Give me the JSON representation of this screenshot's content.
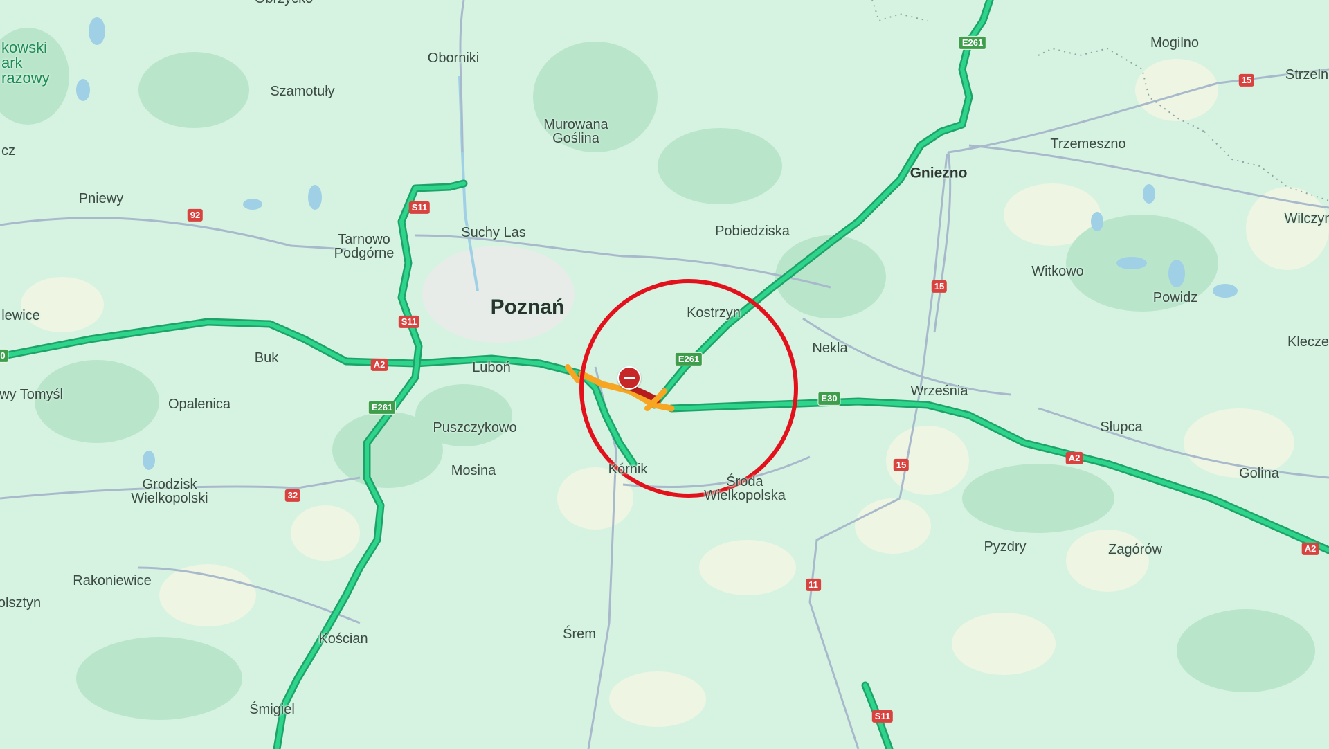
{
  "map": {
    "colors": {
      "land": "#d6f3e2",
      "forest": "#b9e5cb",
      "field": "#eef5e3",
      "water": "#9fd0e6",
      "minor_road": "#a9b9cc",
      "traffic_free_flow": "#23c47a",
      "traffic_slow": "#f6a623",
      "traffic_jam": "#b71c1c",
      "highlight_circle": "#e3111b"
    },
    "cities": [
      {
        "id": "poznan",
        "name": "Poznań"
      },
      {
        "id": "gniezno",
        "name": "Gniezno"
      }
    ],
    "places": [
      {
        "id": "obrzycko",
        "name": "Obrzycko"
      },
      {
        "id": "oborniki",
        "name": "Oborniki"
      },
      {
        "id": "mogilno",
        "name": "Mogilno"
      },
      {
        "id": "strzelno",
        "name": "Strzeln"
      },
      {
        "id": "szamotuly",
        "name": "Szamotuły"
      },
      {
        "id": "murowana",
        "name": "Murowana\nGoślina"
      },
      {
        "id": "trzemeszno",
        "name": "Trzemeszno"
      },
      {
        "id": "pniewy",
        "name": "Pniewy"
      },
      {
        "id": "tarnowo",
        "name": "Tarnowo\nPodgórne"
      },
      {
        "id": "suchy_las",
        "name": "Suchy Las"
      },
      {
        "id": "pobiedziska",
        "name": "Pobiedziska"
      },
      {
        "id": "wilczyn",
        "name": "Wilczyn"
      },
      {
        "id": "witkowo",
        "name": "Witkowo"
      },
      {
        "id": "powidz",
        "name": "Powidz"
      },
      {
        "id": "lwowek",
        "name": "lewice"
      },
      {
        "id": "kostrzyn",
        "name": "Kostrzyn"
      },
      {
        "id": "nekla",
        "name": "Nekla"
      },
      {
        "id": "kleczew",
        "name": "Klecze"
      },
      {
        "id": "buk",
        "name": "Buk"
      },
      {
        "id": "lubon",
        "name": "Luboń"
      },
      {
        "id": "wrzesnia",
        "name": "Września"
      },
      {
        "id": "nowy_tomysl",
        "name": "wy Tomyśl"
      },
      {
        "id": "opalenica",
        "name": "Opalenica"
      },
      {
        "id": "puszczykowo",
        "name": "Puszczykowo"
      },
      {
        "id": "slupca",
        "name": "Słupca"
      },
      {
        "id": "mosina",
        "name": "Mosina"
      },
      {
        "id": "kornik",
        "name": "Kórnik"
      },
      {
        "id": "golina",
        "name": "Golina"
      },
      {
        "id": "grodzisk",
        "name": "Grodzisk\nWielkopolski"
      },
      {
        "id": "sroda",
        "name": "Środa\nWielkopolska"
      },
      {
        "id": "pyzdry",
        "name": "Pyzdry"
      },
      {
        "id": "zagorow",
        "name": "Zagórów"
      },
      {
        "id": "rakoniewice",
        "name": "Rakoniewice"
      },
      {
        "id": "wolsztyn",
        "name": "olsztyn"
      },
      {
        "id": "srem",
        "name": "Śrem"
      },
      {
        "id": "koscian",
        "name": "Kościan"
      },
      {
        "id": "smigiel",
        "name": "Śmigiel"
      },
      {
        "id": "edge_cz",
        "name": "cz"
      }
    ],
    "park_label": "kowski\nark\nrazowy",
    "road_shields": [
      {
        "id": "e261_north",
        "label": "E261",
        "color": "green"
      },
      {
        "id": "r15_east",
        "label": "15",
        "color": "red"
      },
      {
        "id": "s11_north",
        "label": "S11",
        "color": "red"
      },
      {
        "id": "r92",
        "label": "92",
        "color": "red"
      },
      {
        "id": "r15_mid",
        "label": "15",
        "color": "red"
      },
      {
        "id": "s11_mid",
        "label": "S11",
        "color": "red"
      },
      {
        "id": "e261_center",
        "label": "E261",
        "color": "green"
      },
      {
        "id": "a2_west",
        "label": "A2",
        "color": "red"
      },
      {
        "id": "e30",
        "label": "E30",
        "color": "green"
      },
      {
        "id": "e261_south",
        "label": "E261",
        "color": "green"
      },
      {
        "id": "r15_south",
        "label": "15",
        "color": "red"
      },
      {
        "id": "a2_east",
        "label": "A2",
        "color": "red"
      },
      {
        "id": "r32",
        "label": "32",
        "color": "red"
      },
      {
        "id": "a2_far_east",
        "label": "A2",
        "color": "red"
      },
      {
        "id": "r11",
        "label": "11",
        "color": "red"
      },
      {
        "id": "s11_south",
        "label": "S11",
        "color": "red"
      },
      {
        "id": "a2_edge",
        "label": "0",
        "color": "green"
      }
    ],
    "incident": {
      "type": "road-closure",
      "icon": "road-closed-icon"
    }
  }
}
